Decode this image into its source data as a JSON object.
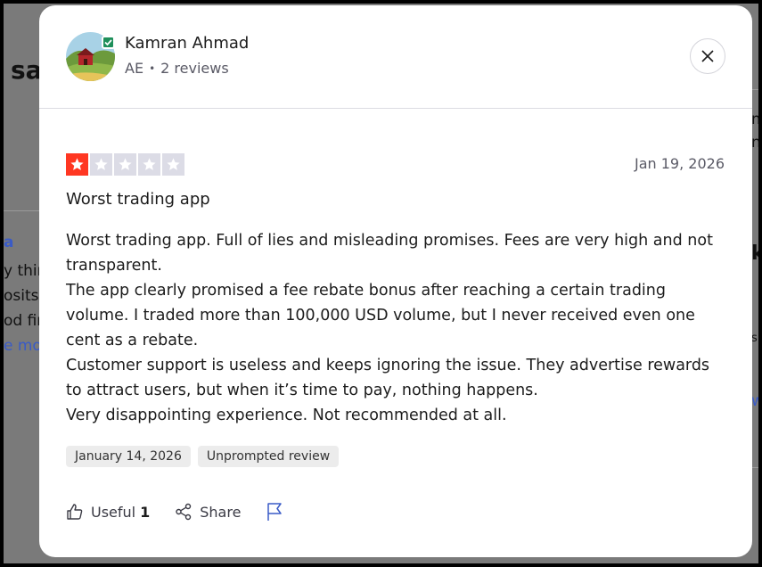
{
  "background": {
    "fragments": [
      "sa",
      "y thin",
      "osits",
      "od fin",
      "e mo",
      "a",
      "m",
      "ne",
      "k",
      "s",
      "w"
    ]
  },
  "reviewer": {
    "name": "Kamran Ahmad",
    "country": "AE",
    "separator": "•",
    "reviews_count": "2 reviews",
    "verified_icon": "check-icon"
  },
  "review": {
    "rating": 1,
    "max_rating": 5,
    "rating_color": "#ff3722",
    "date": "Jan 19, 2026",
    "title": "Worst trading app",
    "paragraphs": [
      "Worst trading app. Full of lies and misleading promises. Fees are very high and not transparent.",
      "The app clearly promised a fee rebate bonus after reaching a certain trading volume. I traded more than 100,000 USD volume, but I never received even one cent as a rebate.",
      "Customer support is useless and keeps ignoring the issue. They advertise rewards to attract users, but when it’s time to pay, nothing happens.",
      "Very disappointing experience. Not recommended at all."
    ],
    "tags": [
      "January 14, 2026",
      "Unprompted review"
    ]
  },
  "actions": {
    "useful_label": "Useful",
    "useful_count": "1",
    "share_label": "Share",
    "report_icon": "flag-icon"
  }
}
